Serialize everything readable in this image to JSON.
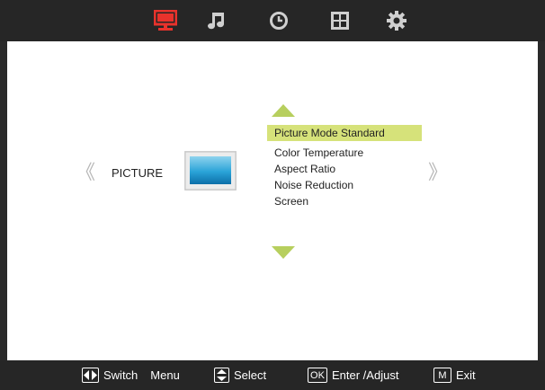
{
  "top_tabs": [
    {
      "icon": "monitor-icon",
      "color": "#e8322c",
      "active": true
    },
    {
      "icon": "music-note-icon",
      "color": "#cfcfcf",
      "active": false
    },
    {
      "icon": "clock-icon",
      "color": "#cfcfcf",
      "active": false
    },
    {
      "icon": "grid-icon",
      "color": "#cfcfcf",
      "active": false
    },
    {
      "icon": "gear-icon",
      "color": "#cfcfcf",
      "active": false
    }
  ],
  "section": {
    "label": "PICTURE",
    "left_arrow": "《",
    "right_arrow": "》"
  },
  "menu": {
    "items": [
      {
        "label": "Picture Mode Standard",
        "selected": true
      },
      {
        "label": "Color Temperature",
        "selected": false
      },
      {
        "label": "Aspect Ratio",
        "selected": false
      },
      {
        "label": "Noise Reduction",
        "selected": false
      },
      {
        "label": "Screen",
        "selected": false
      }
    ],
    "highlight_color": "#d6e27a",
    "arrow_color": "#b7cf5e"
  },
  "help_bar": {
    "switch_label": "Switch",
    "menu_label": "Menu",
    "select_label": "Select",
    "ok_key": "OK",
    "enter_label": "Enter /Adjust",
    "m_key": "M",
    "exit_label": "Exit"
  }
}
